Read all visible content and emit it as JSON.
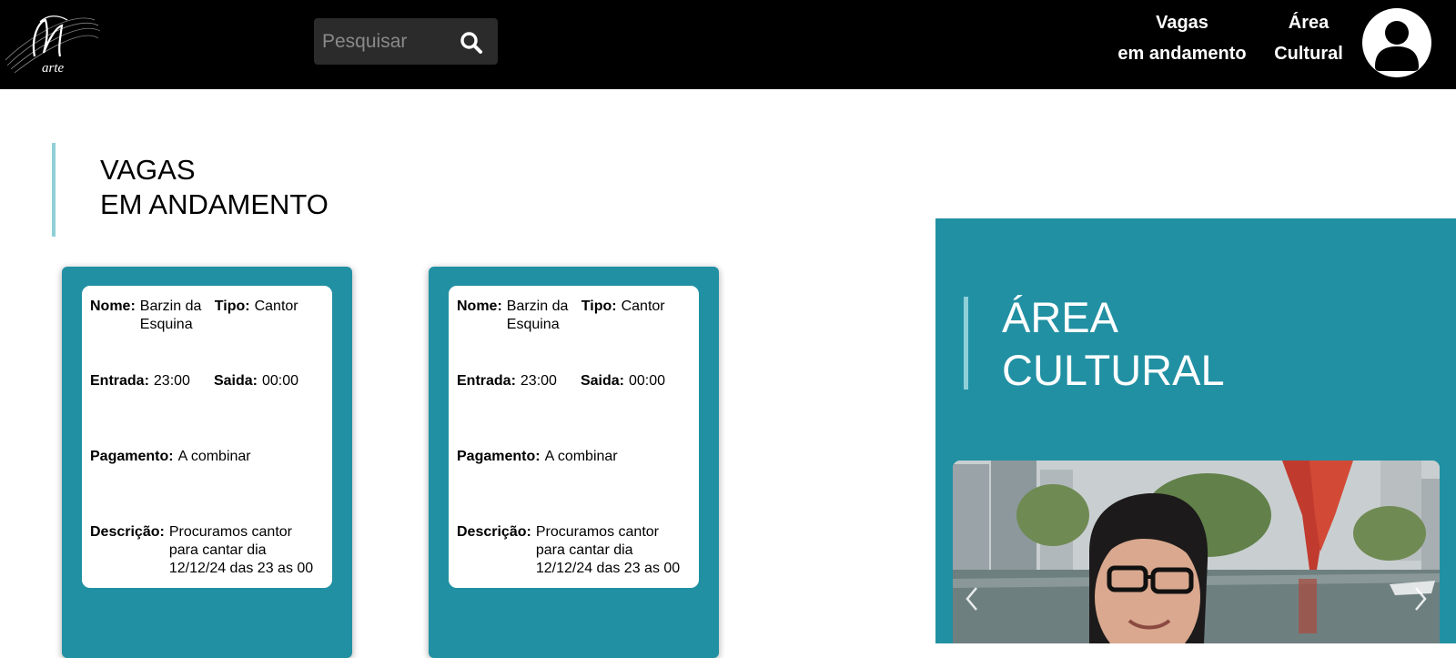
{
  "header": {
    "logo_text": "arte",
    "search": {
      "placeholder": "Pesquisar",
      "value": ""
    },
    "nav": [
      {
        "line1": "Vagas",
        "line2": "em andamento"
      },
      {
        "line1": "Área",
        "line2": "Cultural"
      }
    ]
  },
  "section": {
    "title_line1": "VAGAS",
    "title_line2": "EM ANDAMENTO"
  },
  "labels": {
    "nome": "Nome:",
    "tipo": "Tipo:",
    "entrada": "Entrada:",
    "saida": "Saida:",
    "pagamento": "Pagamento:",
    "descricao": "Descrição:"
  },
  "jobs": [
    {
      "nome": "Barzin da Esquina",
      "tipo": "Cantor",
      "entrada": "23:00",
      "saida": "00:00",
      "pagamento": "A combinar",
      "descricao": "Procuramos cantor para cantar dia 12/12/24 das 23 as 00"
    },
    {
      "nome": "Barzin da Esquina",
      "tipo": "Cantor",
      "entrada": "23:00",
      "saida": "00:00",
      "pagamento": "A combinar",
      "descricao": "Procuramos cantor para cantar dia 12/12/24 das 23 as 00"
    }
  ],
  "cultural": {
    "title_line1": "ÁREA",
    "title_line2": "CULTURAL"
  },
  "icons": {
    "search": "search-icon",
    "user": "user-icon",
    "prev": "chevron-left-icon",
    "next": "chevron-right-icon"
  },
  "colors": {
    "topbar": "#000000",
    "accent": "#2190a3",
    "accent_light": "#8fd0d8"
  }
}
